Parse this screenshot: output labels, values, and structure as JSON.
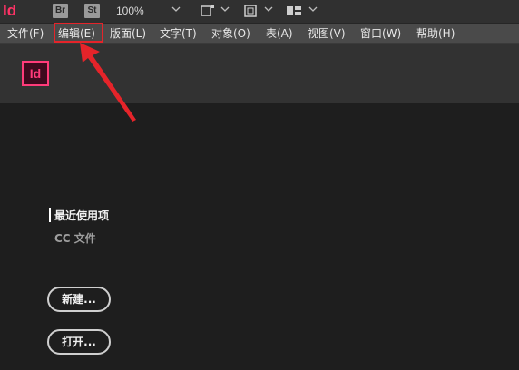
{
  "appbar": {
    "logo": "Id",
    "bridge_label": "Br",
    "stock_label": "St",
    "zoom": "100%"
  },
  "menu": {
    "items": [
      {
        "label": "文件(F)"
      },
      {
        "label": "编辑(E)"
      },
      {
        "label": "版面(L)"
      },
      {
        "label": "文字(T)"
      },
      {
        "label": "对象(O)"
      },
      {
        "label": "表(A)"
      },
      {
        "label": "视图(V)"
      },
      {
        "label": "窗口(W)"
      },
      {
        "label": "帮助(H)"
      }
    ],
    "highlighted": "编辑(E)"
  },
  "start_panel": {
    "logo": "Id",
    "nav_recent": "最近使用项",
    "nav_cc": "CC 文件",
    "new_button": "新建...",
    "open_button": "打开..."
  },
  "colors": {
    "brand_pink": "#ff3b7a",
    "annotation_red": "#e5242a"
  }
}
